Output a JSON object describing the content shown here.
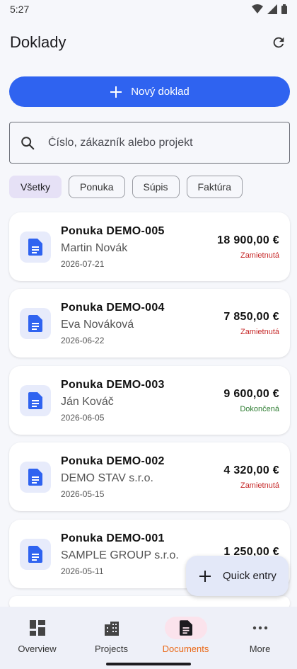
{
  "status_bar": {
    "time": "5:27"
  },
  "app_bar": {
    "title": "Doklady"
  },
  "primary_action": {
    "label": "Nový doklad"
  },
  "search": {
    "placeholder": "Číslo, zákazník alebo projekt"
  },
  "filters": [
    {
      "label": "Všetky",
      "active": true
    },
    {
      "label": "Ponuka",
      "active": false
    },
    {
      "label": "Súpis",
      "active": false
    },
    {
      "label": "Faktúra",
      "active": false
    }
  ],
  "documents": [
    {
      "title": "Ponuka DEMO-005",
      "customer": "Martin Novák",
      "date": "2026-07-21",
      "amount": "18 900,00 €",
      "status": "Zamietnutá",
      "status_type": "red"
    },
    {
      "title": "Ponuka DEMO-004",
      "customer": "Eva Nováková",
      "date": "2026-06-22",
      "amount": "7 850,00 €",
      "status": "Zamietnutá",
      "status_type": "red"
    },
    {
      "title": "Ponuka DEMO-003",
      "customer": "Ján Kováč",
      "date": "2026-06-05",
      "amount": "9 600,00 €",
      "status": "Dokončená",
      "status_type": "green"
    },
    {
      "title": "Ponuka DEMO-002",
      "customer": "DEMO STAV s.r.o.",
      "date": "2026-05-15",
      "amount": "4 320,00 €",
      "status": "Zamietnutá",
      "status_type": "red"
    },
    {
      "title": "Ponuka DEMO-001",
      "customer": "SAMPLE GROUP s.r.o.",
      "date": "2026-05-11",
      "amount": "1 250,00 €",
      "status": "",
      "status_type": "red"
    }
  ],
  "fab": {
    "label": "Quick entry"
  },
  "bottom_nav": [
    {
      "label": "Overview",
      "icon": "dashboard-icon",
      "active": false
    },
    {
      "label": "Projects",
      "icon": "building-icon",
      "active": false
    },
    {
      "label": "Documents",
      "icon": "document-icon",
      "active": true
    },
    {
      "label": "More",
      "icon": "more-icon",
      "active": false
    }
  ],
  "colors": {
    "primary": "#2f63f0",
    "active_nav": "#ea6a1a",
    "rejected": "#c62828",
    "completed": "#2e7d32"
  }
}
